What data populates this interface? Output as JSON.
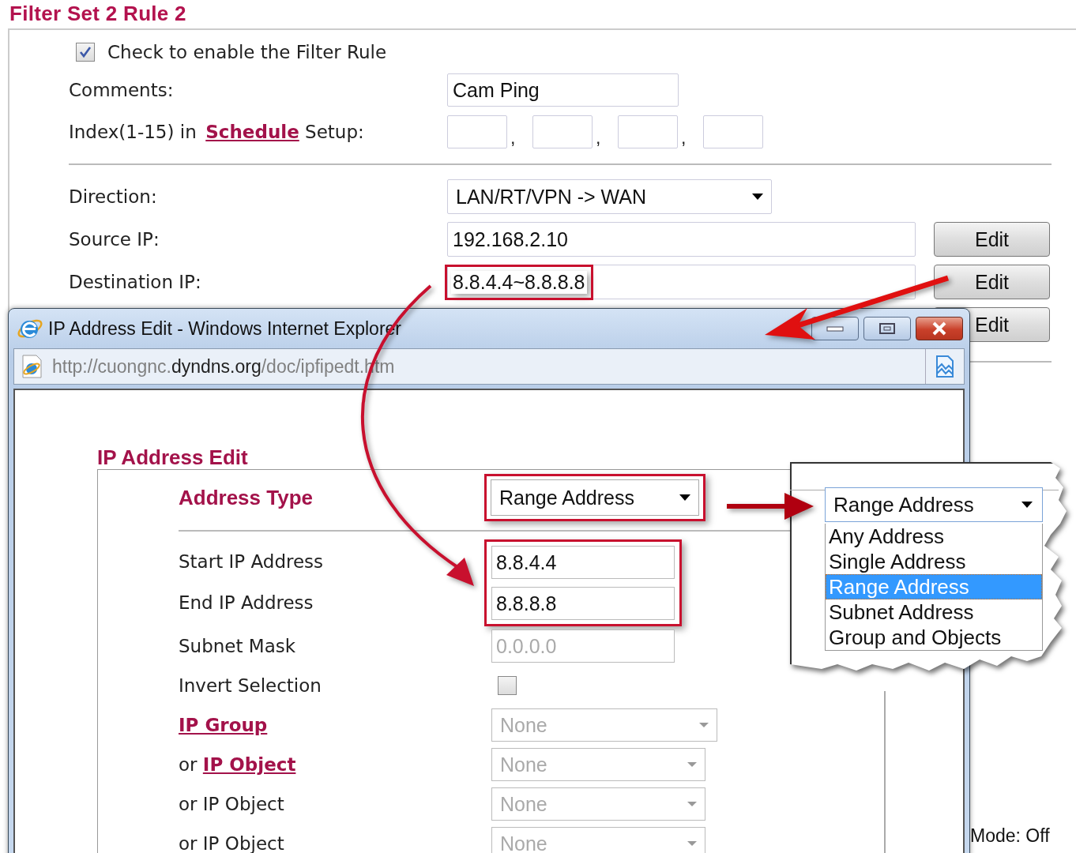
{
  "page_title": "Filter Set 2 Rule 2",
  "rule": {
    "enable": {
      "label": "Check to enable the Filter Rule",
      "checked": true
    },
    "comments": {
      "label": "Comments:",
      "value": "Cam Ping"
    },
    "schedule": {
      "label_before": "Index(1-15) in",
      "link": "Schedule",
      "label_after": "Setup:",
      "separators": [
        ",",
        ",",
        ","
      ]
    },
    "direction": {
      "label": "Direction:",
      "value": "LAN/RT/VPN -> WAN"
    },
    "ip_rows": [
      {
        "label": "Source IP:",
        "value": "192.168.2.10",
        "button": "Edit",
        "highlighted": false
      },
      {
        "label": "Destination IP:",
        "value": "8.8.4.4~8.8.8.8",
        "button": "Edit",
        "highlighted": true
      }
    ],
    "extra_button": "Edit"
  },
  "status_text": "Mode: Off",
  "popup": {
    "title": "IP Address Edit - Windows Internet Explorer",
    "url": "http://cuongnc.**dyndns.org**/doc/ipfipedt.htm",
    "heading": "IP Address Edit",
    "address_type": {
      "label": "Address Type",
      "value": "Range Address",
      "highlighted": true
    },
    "fields": [
      {
        "kind": "text",
        "label": "Start IP Address",
        "value": "8.8.4.4",
        "disabled": false,
        "highlighted": true
      },
      {
        "kind": "text",
        "label": "End IP Address",
        "value": "8.8.8.8",
        "disabled": false,
        "highlighted": true
      },
      {
        "kind": "text",
        "label": "Subnet Mask",
        "value": "0.0.0.0",
        "disabled": true,
        "highlighted": false
      },
      {
        "kind": "checkbox",
        "label": "Invert Selection",
        "checked": false
      },
      {
        "kind": "select",
        "link": "IP Group",
        "value": "None",
        "disabled": true
      },
      {
        "kind": "select",
        "prefix": "or",
        "link": "IP Object",
        "value": "None",
        "disabled": true
      },
      {
        "kind": "select",
        "label": "or IP Object",
        "value": "None",
        "disabled": true
      },
      {
        "kind": "select",
        "label": "or IP Object",
        "value": "None",
        "disabled": true
      }
    ]
  },
  "dropdown_callout": {
    "value": "Range Address",
    "options": [
      {
        "label": "Any Address",
        "selected": false
      },
      {
        "label": "Single Address",
        "selected": false
      },
      {
        "label": "Range Address",
        "selected": true
      },
      {
        "label": "Subnet Address",
        "selected": false
      },
      {
        "label": "Group and Objects",
        "selected": false
      }
    ]
  }
}
